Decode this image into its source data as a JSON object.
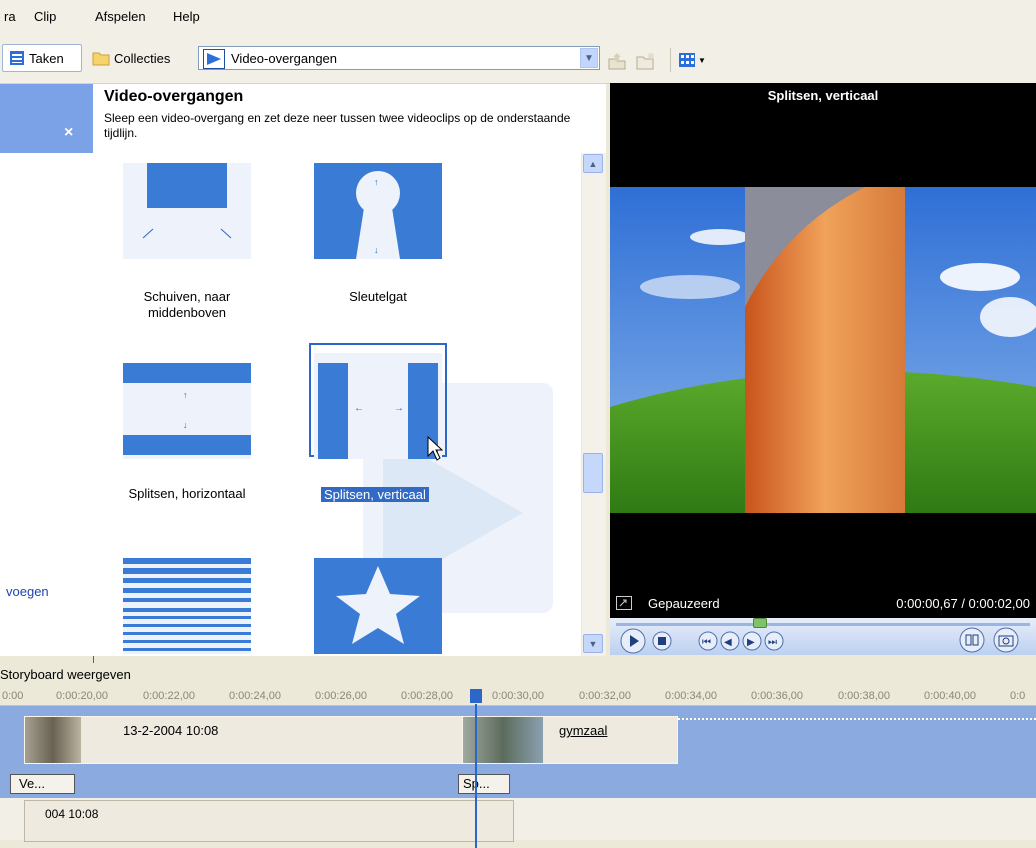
{
  "menu": {
    "items": [
      "ra",
      "Clip",
      "Afspelen",
      "Help"
    ]
  },
  "toolbar": {
    "taken_label": "Taken",
    "collecties_label": "Collecties",
    "combo_value": "Video-overgangen"
  },
  "left_panel": {
    "close_symbol": "×",
    "link_partial": "voegen"
  },
  "collection": {
    "title": "Video-overgangen",
    "description": "Sleep een video-overgang en zet deze neer tussen twee videoclips op de onderstaande tijdlijn.",
    "items": [
      {
        "label": "Schuiven, naar middenboven",
        "icon": "slide-up-middle-icon"
      },
      {
        "label": "Sleutelgat",
        "icon": "keyhole-icon"
      },
      {
        "label": "Splitsen, horizontaal",
        "icon": "split-horizontal-icon"
      },
      {
        "label": "Splitsen, verticaal",
        "icon": "split-vertical-icon",
        "selected": true
      },
      {
        "label": "",
        "icon": "lines-icon"
      },
      {
        "label": "",
        "icon": "star-icon"
      }
    ]
  },
  "preview": {
    "title": "Splitsen, verticaal",
    "status": "Gepauzeerd",
    "time": "0:00:00,67 / 0:00:02,00",
    "seek_fraction": 0.33
  },
  "storyboard": {
    "label": "Storyboard weergeven",
    "ruler_ticks": [
      "0:00",
      "0:00:20,00",
      "0:00:22,00",
      "0:00:24,00",
      "0:00:26,00",
      "0:00:28,00",
      "0:00:30,00",
      "0:00:32,00",
      "0:00:34,00",
      "0:00:36,00",
      "0:00:38,00",
      "0:00:40,00",
      "0:0"
    ],
    "clip1_label": "13-2-2004 10:08",
    "clip2_label": "gymzaal",
    "transition1_label": "Ve...",
    "transition2_label": "Sp...",
    "audio_partial": "004 10:08"
  },
  "colors": {
    "accent": "#2b66c9",
    "panel_blue": "#7ba2e7",
    "icon_blue": "#3a7bd5"
  }
}
